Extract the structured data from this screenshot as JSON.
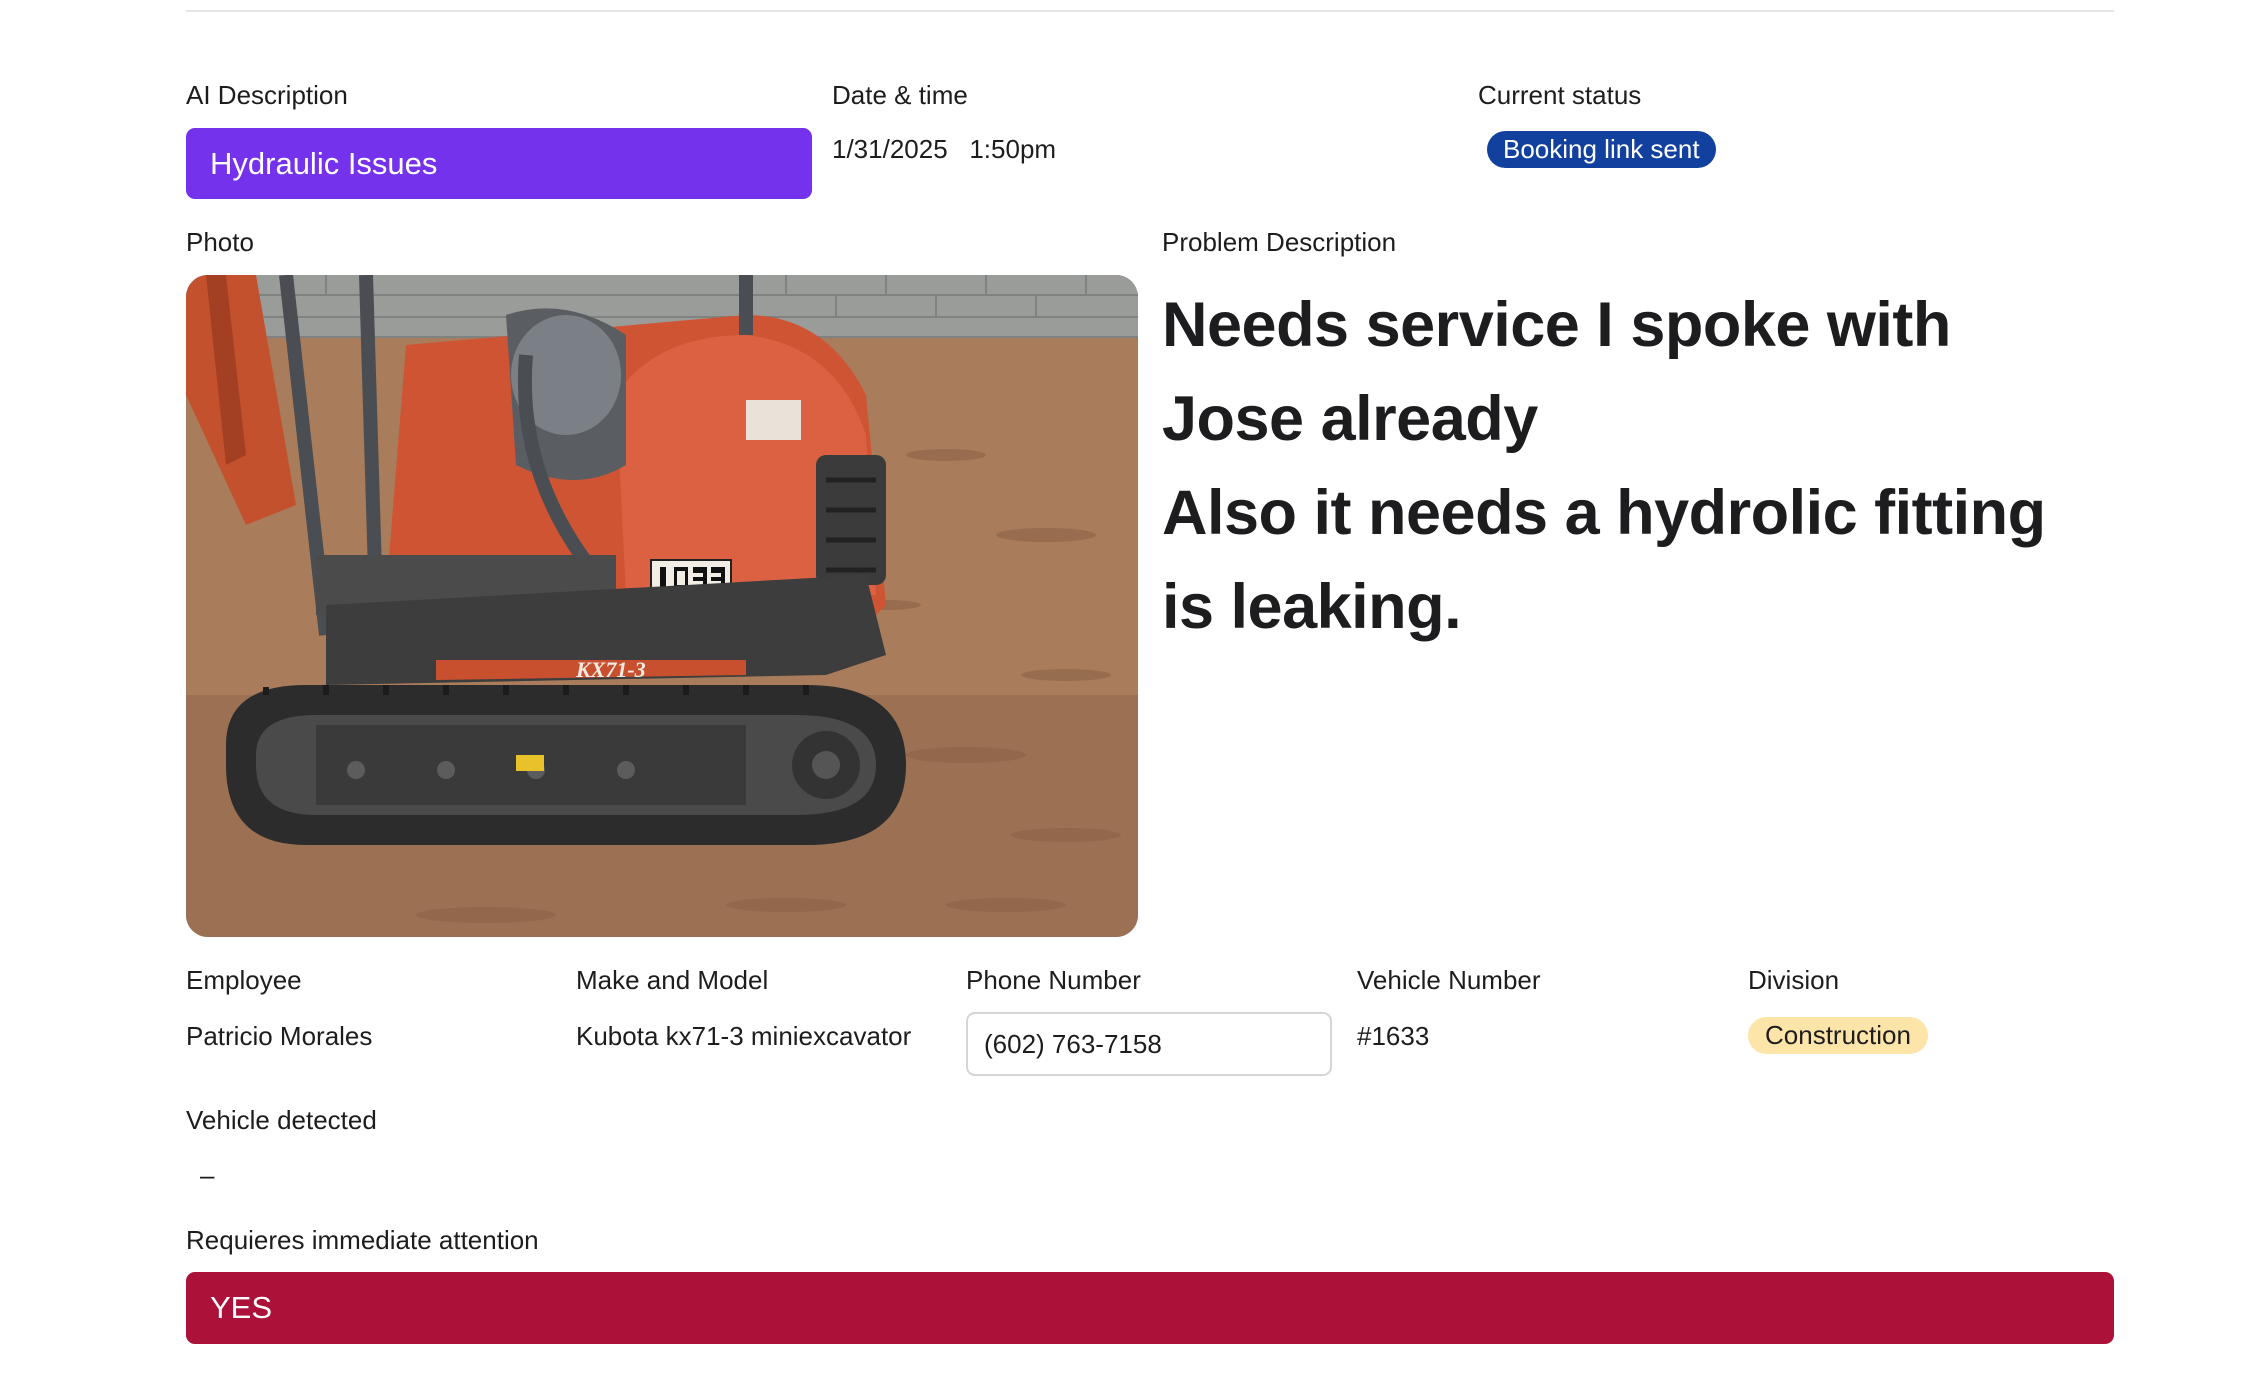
{
  "ai_description": {
    "label": "AI Description",
    "value": "Hydraulic Issues"
  },
  "datetime": {
    "label": "Date & time",
    "value": "1/31/2025   1:50pm"
  },
  "status": {
    "label": "Current status",
    "value": "Booking link sent"
  },
  "photo": {
    "label": "Photo",
    "machine_model_decal": "KX71-3",
    "unit_plate": "1633"
  },
  "problem": {
    "label": "Problem Description",
    "text": "Needs service I spoke with Jose already\nAlso it needs a hydrolic fitting is leaking."
  },
  "employee": {
    "label": "Employee",
    "value": "Patricio Morales"
  },
  "make_model": {
    "label": "Make and Model",
    "value": "Kubota kx71-3 miniexcavator"
  },
  "phone": {
    "label": "Phone Number",
    "value": "(602) 763-7158"
  },
  "vehicle_number": {
    "label": "Vehicle Number",
    "value": "#1633"
  },
  "division": {
    "label": "Division",
    "value": "Construction"
  },
  "vehicle_detected": {
    "label": "Vehicle detected",
    "value": "–"
  },
  "immediate_attention": {
    "label": "Requieres immediate attention",
    "value": "YES"
  },
  "colors": {
    "ai_chip": "#7432ed",
    "status_pill": "#12409e",
    "division_pill": "#fde4a8",
    "urgent_bar": "#ab1139"
  }
}
